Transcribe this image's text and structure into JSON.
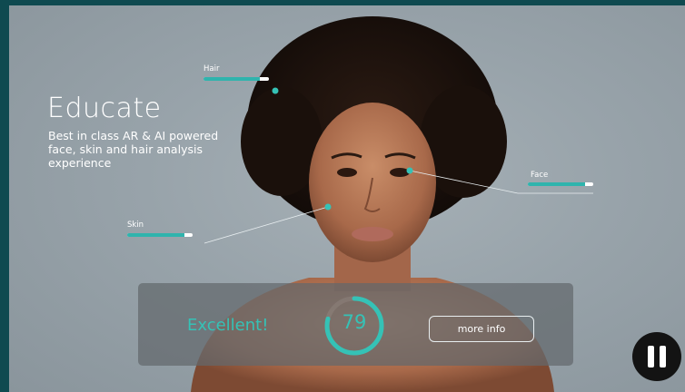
{
  "hero": {
    "title": "Educate",
    "description": "Best in class AR & AI powered face, skin and hair analysis experience"
  },
  "tags": [
    {
      "id": "hair",
      "label": "Hair",
      "level": 0.86
    },
    {
      "id": "face",
      "label": "Face",
      "level": 0.88
    },
    {
      "id": "skin",
      "label": "Skin",
      "level": 0.88
    }
  ],
  "result": {
    "rating": "Excellent!",
    "score": "79",
    "score_fraction": 0.79,
    "more_info_label": "more info"
  },
  "controls": {
    "pause_icon": "pause-icon"
  },
  "colors": {
    "accent": "#35c2b6",
    "frame": "#0f4a50",
    "panel": "#62686c"
  }
}
